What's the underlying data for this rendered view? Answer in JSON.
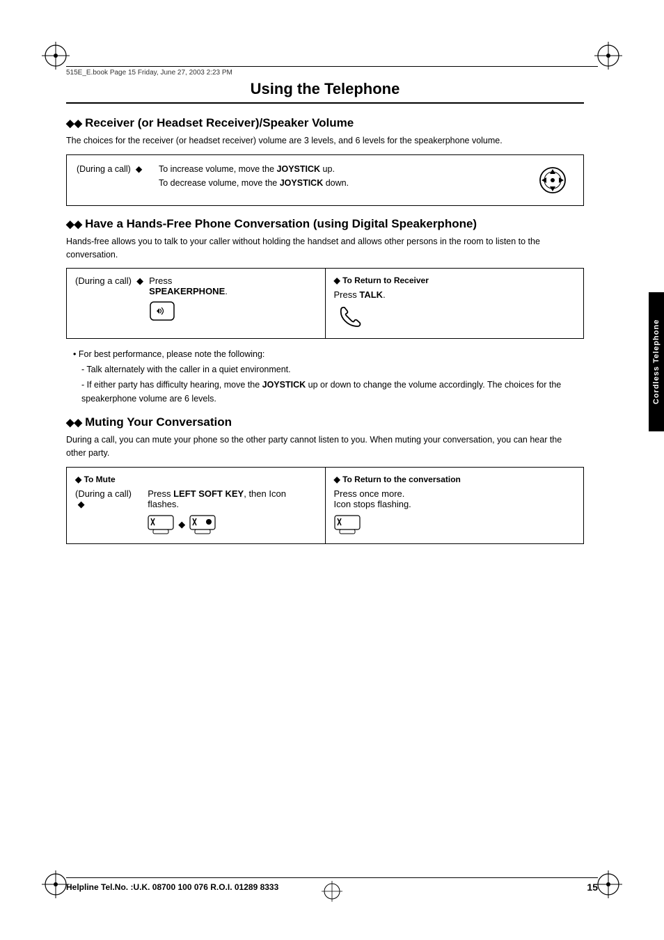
{
  "page": {
    "title": "Using the Telephone",
    "page_number": "15",
    "header_text": "515E_E.book  Page 15  Friday, June 27, 2003  2:23 PM",
    "footer_helpline": "Helpline Tel.No. :U.K. 08700 100 076  R.O.I. 01289 8333",
    "side_tab": "Cordless Telephone"
  },
  "sections": [
    {
      "id": "receiver-volume",
      "heading": "Receiver (or Headset Receiver)/Speaker Volume",
      "desc": "The choices for the receiver (or headset receiver) volume are 3 levels, and 6 levels for the speakerphone volume.",
      "box": {
        "label": "(During a call)",
        "line1": "To increase volume, move the",
        "line1_bold": "JOYSTICK",
        "line1_end": "up.",
        "line2": "To decrease volume, move the",
        "line2_bold": "JOYSTICK",
        "line2_end": "down."
      }
    },
    {
      "id": "speakerphone",
      "heading": "Have a Hands-Free Phone Conversation (using Digital Speakerphone)",
      "desc": "Hands-free allows you to talk to your caller without holding the handset and allows other persons in the room to listen to the conversation.",
      "col_left": {
        "label": "(During a call)",
        "press_text": "Press",
        "press_bold": "SPEAKERPHONE",
        "press_end": "."
      },
      "col_right_header": "To Return to Receiver",
      "col_right": {
        "press_text": "Press",
        "press_bold": "TALK",
        "press_end": "."
      },
      "bullets": [
        {
          "type": "bullet",
          "text": "For best performance, please note the following:"
        },
        {
          "type": "dash",
          "text": "Talk alternately with the caller in a quiet environment."
        },
        {
          "type": "dash",
          "text": "If either party has difficulty hearing, move the JOYSTICK up or down to change the volume accordingly. The choices for the speakerphone volume are 6 levels.",
          "has_bold": "JOYSTICK"
        }
      ]
    },
    {
      "id": "muting",
      "heading": "Muting Your Conversation",
      "desc": "During a call, you can mute your phone so the other party cannot listen to you. When muting your conversation, you can hear the other party.",
      "col_left_header": "To Mute",
      "col_left": {
        "label": "(During a call)",
        "line1": "Press",
        "line1_bold": "LEFT SOFT KEY",
        "line1_end": ", then Icon flashes."
      },
      "col_right_header": "To Return to the conversation",
      "col_right": {
        "line1": "Press once more.",
        "line2": "Icon stops flashing."
      }
    }
  ]
}
